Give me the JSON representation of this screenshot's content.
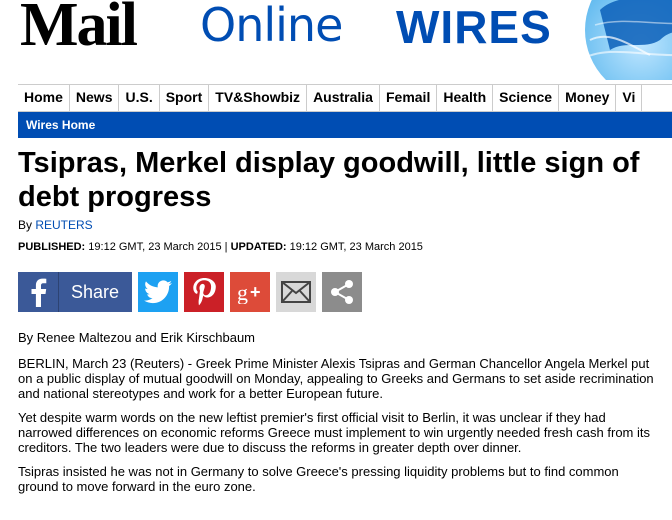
{
  "masthead": {
    "logo_mail": "Mail",
    "logo_online": "Online",
    "section": "WIRES"
  },
  "nav": {
    "items": [
      "Home",
      "News",
      "U.S.",
      "Sport",
      "TV&Showbiz",
      "Australia",
      "Femail",
      "Health",
      "Science",
      "Money",
      "Vi"
    ]
  },
  "subnav": {
    "link": "Wires Home"
  },
  "article": {
    "headline": "Tsipras, Merkel display goodwill, little sign of debt progress",
    "by_prefix": "By ",
    "source": "REUTERS",
    "published_label": "PUBLISHED:",
    "published_value": " 19:12 GMT, 23 March 2015 | ",
    "updated_label": "UPDATED:",
    "updated_value": " 19:12 GMT, 23 March 2015",
    "author_line": "By Renee Maltezou and Erik Kirschbaum",
    "paragraphs": [
      "BERLIN, March 23 (Reuters) - Greek Prime Minister Alexis Tsipras and German Chancellor Angela Merkel put on a public display of mutual goodwill on Monday, appealing to Greeks and Germans to set aside recrimination and national stereotypes and work for a better European future.",
      "Yet despite warm words on the new leftist premier's first official visit to Berlin, it was unclear if they had narrowed differences on economic reforms Greece must implement to win urgently needed fresh cash from its creditors. The two leaders were due to discuss the reforms in greater depth over dinner.",
      "Tsipras insisted he was not in Germany to solve Greece's pressing liquidity problems but to find common ground to move forward in the euro zone."
    ]
  },
  "share": {
    "facebook_label": "Share",
    "icons": [
      "facebook-icon",
      "twitter-icon",
      "pinterest-icon",
      "google-plus-icon",
      "email-icon",
      "share-icon"
    ],
    "colors": {
      "facebook": "#3b5998",
      "twitter": "#1da1f2",
      "pinterest": "#cb2027",
      "googleplus": "#dd4b39",
      "email": "#d8d8d8",
      "share": "#8c8c8c"
    }
  },
  "colors": {
    "brand_blue": "#004db3"
  }
}
